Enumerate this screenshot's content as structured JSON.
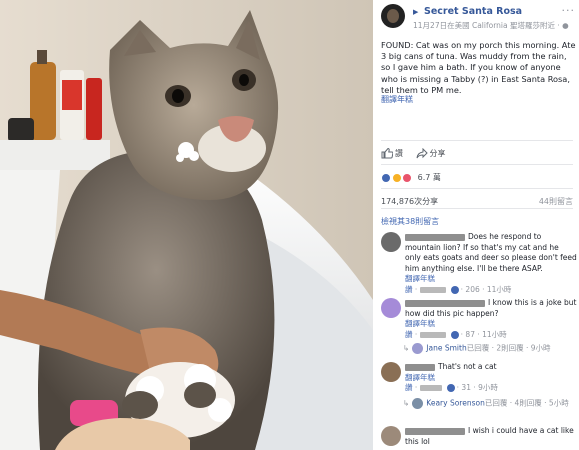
{
  "post": {
    "page_name": "Secret Santa Rosa",
    "timestamp": "11月27日在美國 California 聖塔羅莎附近 · ",
    "text": "FOUND: Cat was on my porch this morning. Ate 3 big cans of tuna. Was muddy from the rain, so I gave him a bath. If you know of anyone who is missing a Tabby (?) in East Santa Rosa, tell them to PM me.",
    "see_translation": "翻譯年糕"
  },
  "actions": {
    "like": "讚",
    "share": "分享"
  },
  "stats": {
    "reaction_count": "6.7 萬",
    "views": "174,876次分享",
    "comments": "44則留言",
    "previous_comments": "檢視其38則留言"
  },
  "comments": [
    {
      "text": "Does he respond to mountain lion? If so that's my cat and he only eats goats and deer so please don't feed him anything else. I'll be there ASAP.",
      "translate": "翻譯年糕",
      "meta_like": "讚",
      "meta_rest": "· 206 · 11小時",
      "avatar_color": "#6a6a6a"
    },
    {
      "text": "I know this is a joke but how did this pic happen?",
      "translate": "翻譯年糕",
      "meta_like": "讚",
      "meta_rest": "· 87 · 11小時",
      "avatar_color": "#a58bd8",
      "reply": {
        "name": "Jane Smith",
        "text": "已回覆 · 2則回覆 · 9小時"
      }
    },
    {
      "text": "That's not a cat",
      "translate": "翻譯年糕",
      "meta_like": "讚",
      "meta_rest": "· 31 · 9小時",
      "avatar_color": "#8a6f55",
      "reply": {
        "name": "Keary Sorenson",
        "text": "已回覆 · 4則回覆 · 5小時"
      }
    },
    {
      "text": "I wish i could have a cat like this lol",
      "avatar_color": "#9c8a7a"
    }
  ],
  "colors": {
    "link": "#365899",
    "accent": "#4267b2",
    "muted": "#90949c",
    "text": "#1d2129"
  }
}
